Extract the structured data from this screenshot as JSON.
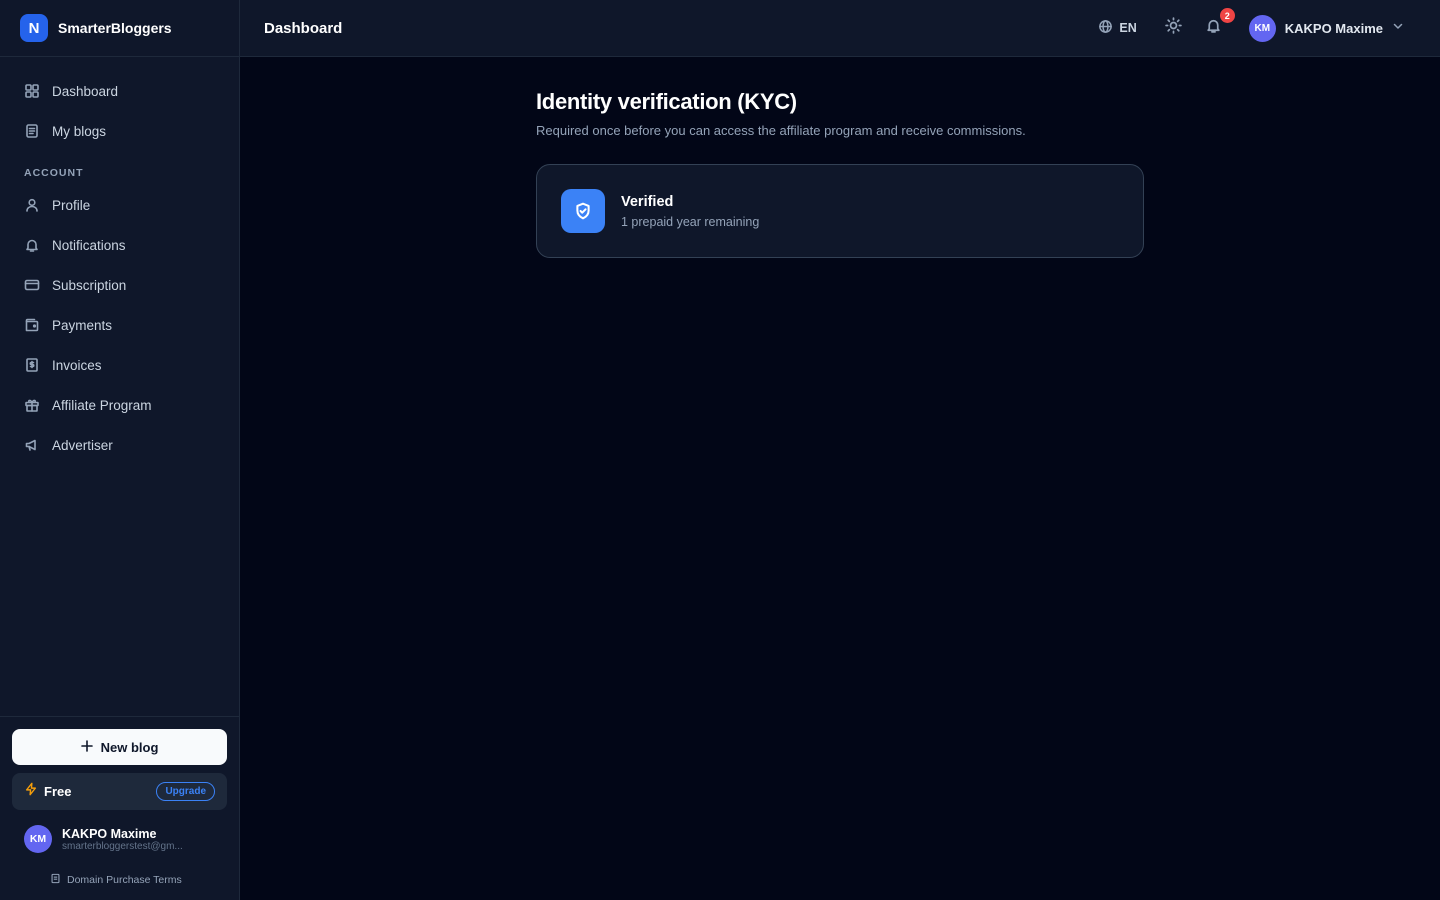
{
  "brand": {
    "logo_letter": "N",
    "name": "SmarterBloggers",
    "color": "#2563eb"
  },
  "header": {
    "title": "Dashboard",
    "language": "EN",
    "notification_count": "2",
    "user_initials": "KM",
    "user_name": "KAKPO Maxime"
  },
  "sidebar": {
    "main_items": [
      {
        "label": "Dashboard",
        "icon": "grid-icon"
      },
      {
        "label": "My blogs",
        "icon": "document-icon"
      }
    ],
    "account_section_label": "ACCOUNT",
    "account_items": [
      {
        "label": "Profile",
        "icon": "user-icon"
      },
      {
        "label": "Notifications",
        "icon": "bell-icon"
      },
      {
        "label": "Subscription",
        "icon": "credit-card-icon"
      },
      {
        "label": "Payments",
        "icon": "wallet-icon"
      },
      {
        "label": "Invoices",
        "icon": "receipt-icon"
      },
      {
        "label": "Affiliate Program",
        "icon": "gift-icon"
      },
      {
        "label": "Advertiser",
        "icon": "megaphone-icon"
      }
    ],
    "new_blog_label": "New blog",
    "plan": {
      "name": "Free",
      "upgrade_label": "Upgrade"
    },
    "user": {
      "initials": "KM",
      "name": "KAKPO Maxime",
      "email": "smarterbloggerstest@gm..."
    },
    "terms_label": "Domain Purchase Terms"
  },
  "main": {
    "title": "Identity verification (KYC)",
    "subtitle": "Required once before you can access the affiliate program and receive commissions.",
    "status_card": {
      "title": "Verified",
      "subtitle": "1 prepaid year remaining",
      "icon": "shield-check-icon",
      "accent": "#3b82f6"
    }
  },
  "colors": {
    "background": "#020617",
    "panel": "#0f172a",
    "accent": "#3b82f6",
    "badge": "#ef4444",
    "avatar": "#6366f1",
    "plan_icon": "#f59e0b"
  }
}
